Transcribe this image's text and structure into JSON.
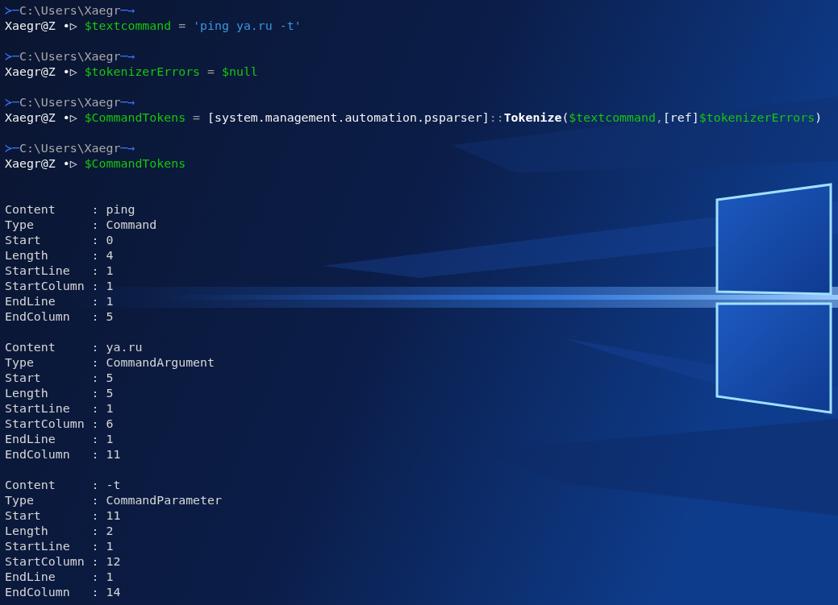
{
  "session": [
    {
      "prompt": {
        "lead": "≻─",
        "path": "C:\\Users\\Xaegr",
        "tail": "─→",
        "user": "Xaegr@Z",
        "dot": "•",
        "caret": "▷"
      },
      "command": [
        {
          "kind": "variable",
          "text": "$textcommand"
        },
        {
          "kind": "operator",
          "text": " = "
        },
        {
          "kind": "string",
          "text": "'ping ya.ru -t'"
        }
      ]
    },
    {
      "prompt": {
        "lead": "≻─",
        "path": "C:\\Users\\Xaegr",
        "tail": "─→",
        "user": "Xaegr@Z",
        "dot": "•",
        "caret": "▷"
      },
      "command": [
        {
          "kind": "variable",
          "text": "$tokenizerErrors"
        },
        {
          "kind": "operator",
          "text": " = "
        },
        {
          "kind": "variable",
          "text": "$null"
        }
      ]
    },
    {
      "prompt": {
        "lead": "≻─",
        "path": "C:\\Users\\Xaegr",
        "tail": "─→",
        "user": "Xaegr@Z",
        "dot": "•",
        "caret": "▷"
      },
      "command": [
        {
          "kind": "variable",
          "text": "$CommandTokens"
        },
        {
          "kind": "operator",
          "text": " = "
        },
        {
          "kind": "plain",
          "text": "[system.management.automation.psparser]"
        },
        {
          "kind": "operator",
          "text": "::"
        },
        {
          "kind": "method",
          "text": "Tokenize"
        },
        {
          "kind": "plain",
          "text": "("
        },
        {
          "kind": "variable",
          "text": "$textcommand"
        },
        {
          "kind": "operator",
          "text": ","
        },
        {
          "kind": "plain",
          "text": "[ref]"
        },
        {
          "kind": "variable",
          "text": "$tokenizerErrors"
        },
        {
          "kind": "plain",
          "text": ")"
        }
      ]
    },
    {
      "prompt": {
        "lead": "≻─",
        "path": "C:\\Users\\Xaegr",
        "tail": "─→",
        "user": "Xaegr@Z",
        "dot": "•",
        "caret": "▷"
      },
      "command": [
        {
          "kind": "variable",
          "text": "$CommandTokens"
        }
      ]
    }
  ],
  "output": {
    "separator": ":",
    "records": [
      {
        "fields": [
          {
            "name": "Content",
            "value": "ping"
          },
          {
            "name": "Type",
            "value": "Command"
          },
          {
            "name": "Start",
            "value": "0"
          },
          {
            "name": "Length",
            "value": "4"
          },
          {
            "name": "StartLine",
            "value": "1"
          },
          {
            "name": "StartColumn",
            "value": "1"
          },
          {
            "name": "EndLine",
            "value": "1"
          },
          {
            "name": "EndColumn",
            "value": "5"
          }
        ]
      },
      {
        "fields": [
          {
            "name": "Content",
            "value": "ya.ru"
          },
          {
            "name": "Type",
            "value": "CommandArgument"
          },
          {
            "name": "Start",
            "value": "5"
          },
          {
            "name": "Length",
            "value": "5"
          },
          {
            "name": "StartLine",
            "value": "1"
          },
          {
            "name": "StartColumn",
            "value": "6"
          },
          {
            "name": "EndLine",
            "value": "1"
          },
          {
            "name": "EndColumn",
            "value": "11"
          }
        ]
      },
      {
        "fields": [
          {
            "name": "Content",
            "value": "-t"
          },
          {
            "name": "Type",
            "value": "CommandParameter"
          },
          {
            "name": "Start",
            "value": "11"
          },
          {
            "name": "Length",
            "value": "2"
          },
          {
            "name": "StartLine",
            "value": "1"
          },
          {
            "name": "StartColumn",
            "value": "12"
          },
          {
            "name": "EndLine",
            "value": "1"
          },
          {
            "name": "EndColumn",
            "value": "14"
          }
        ]
      }
    ]
  }
}
